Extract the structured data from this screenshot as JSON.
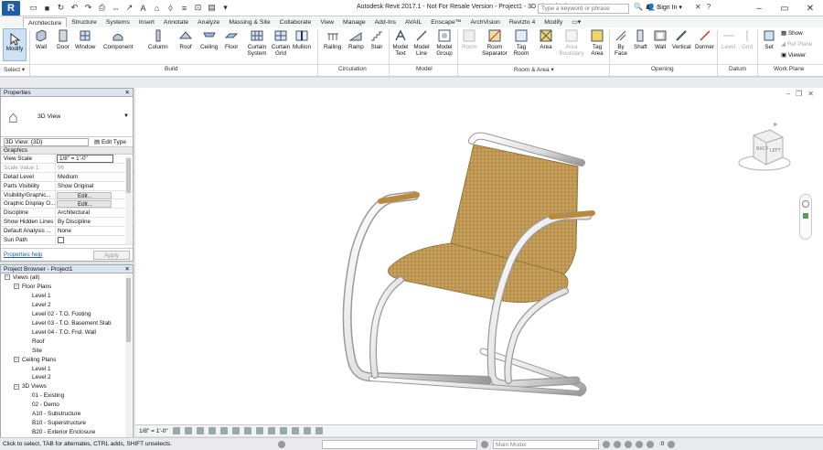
{
  "app": {
    "title": "Autodesk Revit 2017.1 - Not For Resale Version -     Project1 - 3D View: {3D}",
    "search_placeholder": "Type a keyword or phrase",
    "sign_in": "Sign In",
    "logo_letter": "R"
  },
  "tabs": [
    "Architecture",
    "Structure",
    "Systems",
    "Insert",
    "Annotate",
    "Analyze",
    "Massing & Site",
    "Collaborate",
    "View",
    "Manage",
    "Add-Ins",
    "AVAIL",
    "Enscape™",
    "ArchVision",
    "Revizto 4",
    "Modify"
  ],
  "ribbon": {
    "modify": "Modify",
    "select": "Select ▾",
    "buttons": {
      "wall": "Wall",
      "door": "Door",
      "window": "Window",
      "component": "Component",
      "column": "Column",
      "roof": "Roof",
      "ceiling": "Ceiling",
      "floor": "Floor",
      "curtain_system": "Curtain System",
      "curtain_grid": "Curtain Grid",
      "mullion": "Mullion",
      "railing": "Railing",
      "ramp": "Ramp",
      "stair": "Stair",
      "model_text": "Model Text",
      "model_line": "Model Line",
      "model_group": "Model Group",
      "room": "Room",
      "room_separator": "Room Separator",
      "tag_room": "Tag Room",
      "area": "Area",
      "area_boundary": "Area Boundary",
      "tag_area": "Tag Area",
      "by_face": "By Face",
      "shaft": "Shaft",
      "wall_opening": "Wall",
      "vertical": "Vertical",
      "dormer": "Dormer",
      "level": "Level",
      "grid": "Grid",
      "set": "Set",
      "show": "Show",
      "ref_plane": "Ref Plane",
      "viewer": "Viewer"
    },
    "panels": {
      "select": "Select ▾",
      "build": "Build",
      "circulation": "Circulation",
      "model": "Model",
      "room_area": "Room & Area ▾",
      "opening": "Opening",
      "datum": "Datum",
      "work_plane": "Work Plane"
    }
  },
  "properties": {
    "header": "Properties",
    "type_name": "3D View",
    "view_selector": "3D View: {3D}",
    "edit_type": "Edit Type",
    "group": "Graphics",
    "rows": [
      {
        "k": "View Scale",
        "v": "1/8\" = 1'-0\""
      },
      {
        "k": "Scale Value   1:",
        "v": "96"
      },
      {
        "k": "Detail Level",
        "v": "Medium"
      },
      {
        "k": "Parts Visibility",
        "v": "Show Original"
      },
      {
        "k": "Visibility/Graphic...",
        "v": "Edit..."
      },
      {
        "k": "Graphic Display O...",
        "v": "Edit..."
      },
      {
        "k": "Discipline",
        "v": "Architectural"
      },
      {
        "k": "Show Hidden Lines",
        "v": "By Discipline"
      },
      {
        "k": "Default Analysis ...",
        "v": "None"
      },
      {
        "k": "Sun Path",
        "v": ""
      }
    ],
    "help_link": "Properties help",
    "apply": "Apply"
  },
  "browser": {
    "header": "Project Browser - Project1",
    "items": [
      {
        "label": "Views (all)",
        "level": 0,
        "toggle": "−"
      },
      {
        "label": "Floor Plans",
        "level": 1,
        "toggle": "−"
      },
      {
        "label": "Level 1",
        "level": 2
      },
      {
        "label": "Level 2",
        "level": 2
      },
      {
        "label": "Level 02 - T.O. Footing",
        "level": 2
      },
      {
        "label": "Level 03 - T.O. Basement Slab",
        "level": 2
      },
      {
        "label": "Level 04 - T.O. Fnd. Wall",
        "level": 2
      },
      {
        "label": "Roof",
        "level": 2
      },
      {
        "label": "Site",
        "level": 2
      },
      {
        "label": "Ceiling Plans",
        "level": 1,
        "toggle": "−"
      },
      {
        "label": "Level 1",
        "level": 2
      },
      {
        "label": "Level 2",
        "level": 2
      },
      {
        "label": "3D Views",
        "level": 1,
        "toggle": "−"
      },
      {
        "label": "01 - Existing",
        "level": 2
      },
      {
        "label": "02 - Demo",
        "level": 2
      },
      {
        "label": "A10 - Substructure",
        "level": 2
      },
      {
        "label": "B10 - Superstructure",
        "level": 2
      },
      {
        "label": "B20 - Exterior Enclosure",
        "level": 2
      }
    ]
  },
  "viewcube": {
    "back": "BACK",
    "left": "LEFT"
  },
  "view_control": {
    "scale": "1/8\" = 1'-0\""
  },
  "status": {
    "text": "Click to select, TAB for alternates, CTRL adds, SHIFT unselects.",
    "model": "Main Model",
    "filter_count": ":0"
  },
  "colors": {
    "accent": "#1f5ea6",
    "wicker": "#c9a25c",
    "chrome": "#e9e9e9"
  }
}
